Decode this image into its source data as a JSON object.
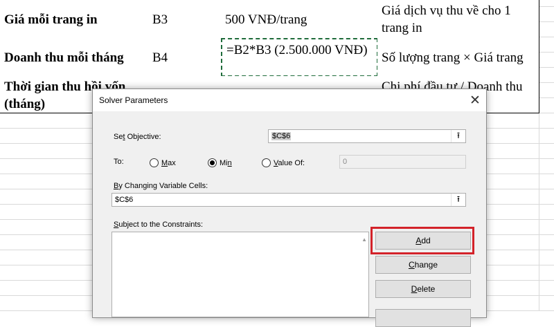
{
  "sheet": {
    "rows": [
      {
        "label": "Giá mỗi trang in",
        "ref": "B3",
        "value": "500 VNĐ/trang",
        "note": "Giá dịch vụ thu về cho 1 trang in"
      },
      {
        "label": "Doanh thu mỗi tháng",
        "ref": "B4",
        "value": "=B2*B3 (2.500.000 VNĐ)",
        "note": "Số lượng trang × Giá trang"
      },
      {
        "label": "Thời gian thu hồi vốn (tháng)",
        "ref": "",
        "value": "",
        "note": "Chi phí đầu tư / Doanh thu"
      }
    ]
  },
  "dialog": {
    "title": "Solver Parameters",
    "close_glyph": "✕",
    "set_objective": {
      "label_pre": "Se",
      "label_key": "t",
      "label_post": " Objective:",
      "value": "$C$6"
    },
    "to": {
      "label": "To:",
      "options": [
        {
          "key": "M",
          "rest": "ax",
          "selected": false
        },
        {
          "key": "",
          "pre": "Mi",
          "keych": "n",
          "rest": "",
          "selected": true
        },
        {
          "pre": "",
          "keych": "V",
          "rest": "alue Of:",
          "selected": false
        }
      ],
      "value_of": "0"
    },
    "changing_cells": {
      "label_key": "B",
      "label_rest": "y Changing Variable Cells:",
      "value": "$C$6"
    },
    "constraints": {
      "label_pre": "",
      "label_key": "S",
      "label_post": "ubject to the Constraints:"
    },
    "ref_icon": "collapse-dialog-icon",
    "buttons": [
      {
        "key": "A",
        "rest": "dd"
      },
      {
        "key": "C",
        "rest": "hange"
      },
      {
        "key": "D",
        "rest": "elete"
      }
    ],
    "highlight_color": "#d32229"
  }
}
